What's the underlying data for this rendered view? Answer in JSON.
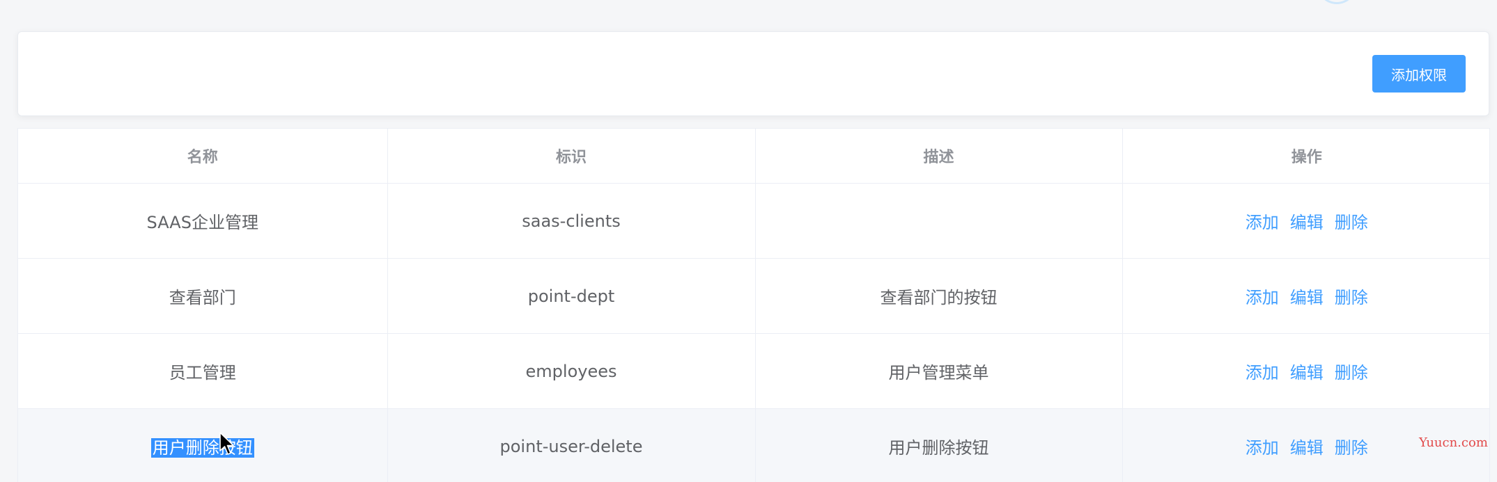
{
  "toolbar": {
    "add_permission_label": "添加权限"
  },
  "table": {
    "headers": [
      "名称",
      "标识",
      "描述",
      "操作"
    ],
    "rows": [
      {
        "name": "SAAS企业管理",
        "code": "saas-clients",
        "description": ""
      },
      {
        "name": "查看部门",
        "code": "point-dept",
        "description": "查看部门的按钮"
      },
      {
        "name": "员工管理",
        "code": "employees",
        "description": "用户管理菜单"
      },
      {
        "name": "用户删除按钮",
        "code": "point-user-delete",
        "description": "用户删除按钮"
      }
    ],
    "actions": {
      "add": "添加",
      "edit": "编辑",
      "delete": "删除"
    }
  },
  "watermark": {
    "text": "Yuucn.com"
  },
  "colors": {
    "primary": "#409eff",
    "selection": "#3390ff",
    "watermark": "#e24a4a"
  }
}
